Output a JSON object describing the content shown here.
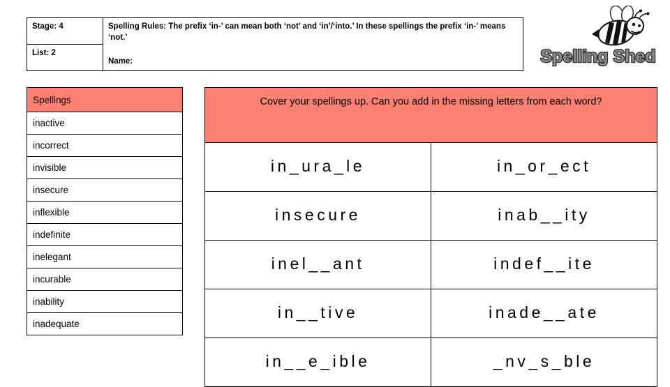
{
  "header": {
    "stage_label": "Stage: 4",
    "list_label": "List: 2",
    "rules_text": "Spelling Rules: The prefix ‘in-’  can mean both ‘not’ and ‘in’/‘into.’ In these spellings the prefix ‘in-’ means ‘not.’",
    "name_label": "Name:"
  },
  "logo": {
    "brand_text": "Spelling Shed",
    "bee_icon": "bee-icon"
  },
  "spellings": {
    "header": "Spellings",
    "words": [
      "inactive",
      "incorrect",
      "invisible",
      "insecure",
      "inflexible",
      "indefinite",
      "inelegant",
      "incurable",
      "inability",
      "inadequate"
    ]
  },
  "exercise": {
    "instruction": "Cover your spellings up. Can you add in the missing letters from each word?",
    "rows": [
      {
        "left": "in_ura_le",
        "right": "in_or_ect"
      },
      {
        "left": "insecure",
        "right": "inab__ity"
      },
      {
        "left": "inel__ant",
        "right": "indef__ite"
      },
      {
        "left": "in__tive",
        "right": "inade__ate"
      },
      {
        "left": "in__e_ible",
        "right": "_nv_s_ble"
      }
    ]
  },
  "colors": {
    "accent": "#FA8072",
    "border": "#000000",
    "page": "#FFFFFF"
  }
}
